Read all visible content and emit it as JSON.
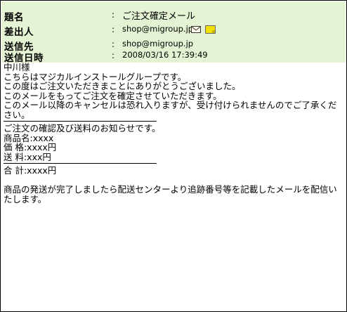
{
  "header": {
    "subject_label": "題名",
    "subject": "ご注文確定メール",
    "from_label": "差出人",
    "from": "shop@migroup.jp",
    "to_label": "送信先",
    "to": "shop@migroup.jp",
    "date_label": "送信日時",
    "date": "2008/03/16 17:39:49",
    "separator": ":",
    "icons": [
      "mail-icon",
      "note-icon"
    ],
    "background": "#e3f3d3"
  },
  "body": {
    "greeting": "中川様",
    "p1": "こちらはマジカルインストールグループです。",
    "p2": "この度はご注文いただきまことにありがとうございました。",
    "p3": "このメールをもってご注文を確定させていただきます。",
    "p4": "このメール以降のキャンセルは恐れ入りますが、受け付けられませんのでご了承ください。",
    "notice": "ご注文の確認及び送料のお知らせです。",
    "product": "商品名:xxxx",
    "price": "価 格:xxxx円",
    "shipping": "送 料:xxx円",
    "total": "合 計:xxxx円",
    "closing": "商品の発送が完了しましたら配送センターより追跡番号等を記載したメールを配信いたします。"
  }
}
